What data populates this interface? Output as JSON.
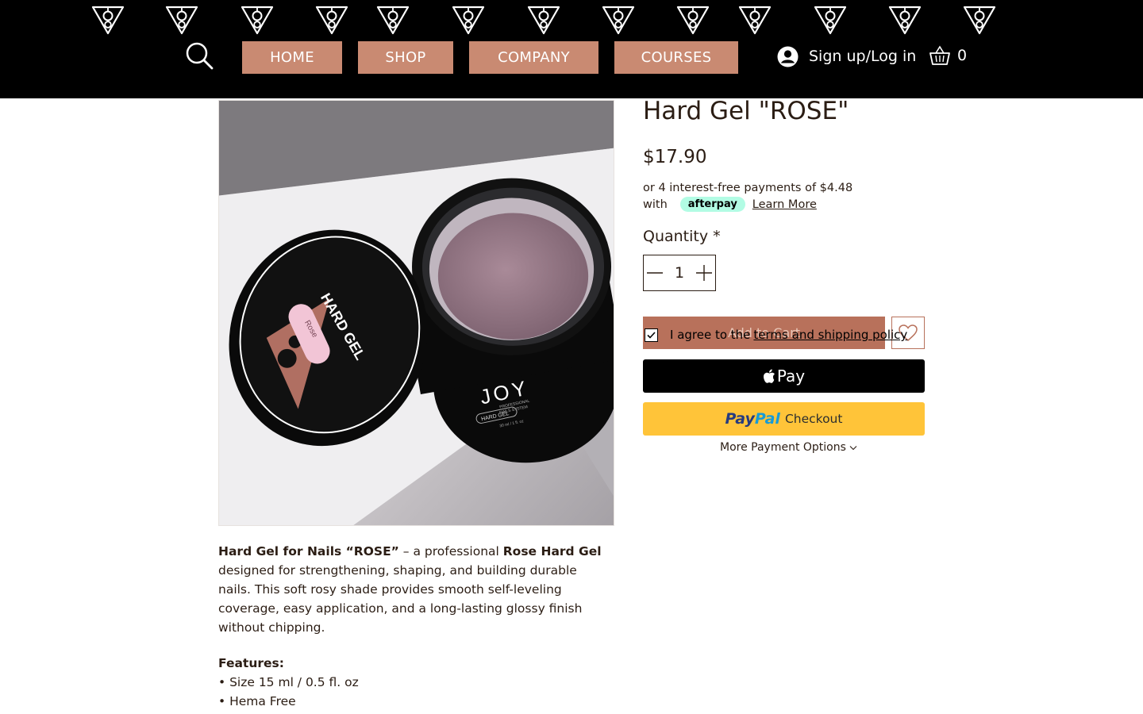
{
  "nav": {
    "items": [
      "HOME",
      "SHOP",
      "COMPANY",
      "COURSES"
    ],
    "login_label": "Sign up/Log in",
    "cart_count": "0"
  },
  "product": {
    "title": "Hard Gel \"ROSE\"",
    "price": "$17.90",
    "afterpay_line1": "or 4 interest-free payments of $4.48",
    "afterpay_with": "with",
    "afterpay_brand": "afterpay",
    "learn_more": "Learn More",
    "quantity_label": "Quantity",
    "quantity_required": "*",
    "quantity_value": "1",
    "add_to_cart": "Add to Cart",
    "agree_text": "I agree to the",
    "terms_link": "terms and shipping policy",
    "apple_pay": "Pay",
    "paypal_pay": "Pay",
    "paypal_pal": "Pal",
    "paypal_checkout": "Checkout",
    "more_payment": "More Payment Options",
    "image_text": {
      "lid_label": "HARD GEL",
      "lid_shade": "Rose",
      "jar_brand": "JOY",
      "jar_sub1": "PROFESSIONAL",
      "jar_sub2": "NAILS SYSTEM",
      "jar_type": "HARD GEL",
      "jar_volume": "30 ml / 1 fl. oz"
    }
  },
  "description": {
    "p1_bold1": "Hard Gel for Nails “ROSE”",
    "p1_text1": " – a professional ",
    "p1_bold2": "Rose Hard Gel",
    "p1_text2": " designed for strengthening, shaping, and building durable nails. This soft rosy shade provides smooth self-leveling coverage, easy application, and a long-lasting glossy finish without chipping.",
    "features_title": "Features:",
    "features": [
      "• Size 15 ml / 0.5 fl. oz",
      "• Hema Free"
    ]
  },
  "colors": {
    "header_bg": "#000000",
    "nav_button": "#c98a72",
    "add_to_cart": "#b8715b",
    "text": "#2b1d14",
    "afterpay": "#b2fce4",
    "paypal": "#ffc439"
  },
  "icons": [
    "brand-logo-icon",
    "search-icon",
    "user-avatar-icon",
    "cart-basket-icon",
    "minus-icon",
    "plus-icon",
    "heart-icon",
    "check-icon",
    "apple-icon",
    "chevron-down-icon"
  ]
}
